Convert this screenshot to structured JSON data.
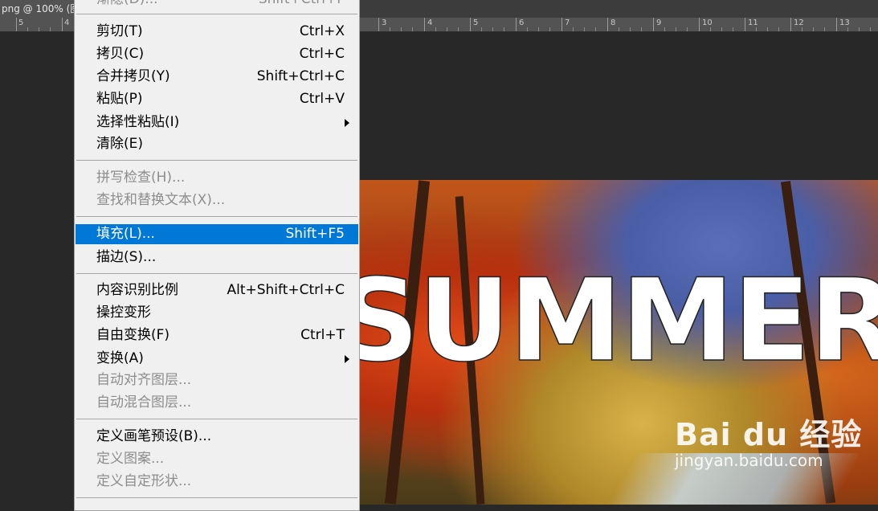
{
  "document": {
    "tab_title": "png @ 100% (图"
  },
  "ruler": {
    "numbers": [
      "5",
      "4",
      "3",
      "4",
      "5",
      "6",
      "7",
      "8",
      "9",
      "10",
      "11",
      "12",
      "13"
    ]
  },
  "canvas": {
    "overlay_text": "SUMMER"
  },
  "watermark": {
    "brand": "Bai du 经验",
    "url": "jingyan.baidu.com"
  },
  "menu": {
    "top_partial": {
      "label": "渐隐(D)...",
      "shortcut": "Shift+Ctrl+F"
    },
    "groups": [
      [
        {
          "label": "剪切(T)",
          "shortcut": "Ctrl+X",
          "enabled": true
        },
        {
          "label": "拷贝(C)",
          "shortcut": "Ctrl+C",
          "enabled": true
        },
        {
          "label": "合并拷贝(Y)",
          "shortcut": "Shift+Ctrl+C",
          "enabled": true
        },
        {
          "label": "粘贴(P)",
          "shortcut": "Ctrl+V",
          "enabled": true
        },
        {
          "label": "选择性粘贴(I)",
          "shortcut": "",
          "enabled": true,
          "submenu": true
        },
        {
          "label": "清除(E)",
          "shortcut": "",
          "enabled": true
        }
      ],
      [
        {
          "label": "拼写检查(H)...",
          "shortcut": "",
          "enabled": false
        },
        {
          "label": "查找和替换文本(X)...",
          "shortcut": "",
          "enabled": false
        }
      ],
      [
        {
          "label": "填充(L)...",
          "shortcut": "Shift+F5",
          "enabled": true,
          "highlighted": true
        },
        {
          "label": "描边(S)...",
          "shortcut": "",
          "enabled": true
        }
      ],
      [
        {
          "label": "内容识别比例",
          "shortcut": "Alt+Shift+Ctrl+C",
          "enabled": true
        },
        {
          "label": "操控变形",
          "shortcut": "",
          "enabled": true
        },
        {
          "label": "自由变换(F)",
          "shortcut": "Ctrl+T",
          "enabled": true
        },
        {
          "label": "变换(A)",
          "shortcut": "",
          "enabled": true,
          "submenu": true
        },
        {
          "label": "自动对齐图层...",
          "shortcut": "",
          "enabled": false
        },
        {
          "label": "自动混合图层...",
          "shortcut": "",
          "enabled": false
        }
      ],
      [
        {
          "label": "定义画笔预设(B)...",
          "shortcut": "",
          "enabled": true
        },
        {
          "label": "定义图案...",
          "shortcut": "",
          "enabled": false
        },
        {
          "label": "定义自定形状...",
          "shortcut": "",
          "enabled": false
        }
      ]
    ]
  },
  "colors": {
    "highlight": "#0078d7",
    "menu_bg": "#f0f0f0",
    "disabled_text": "#8d8d8d",
    "workspace": "#282828"
  }
}
